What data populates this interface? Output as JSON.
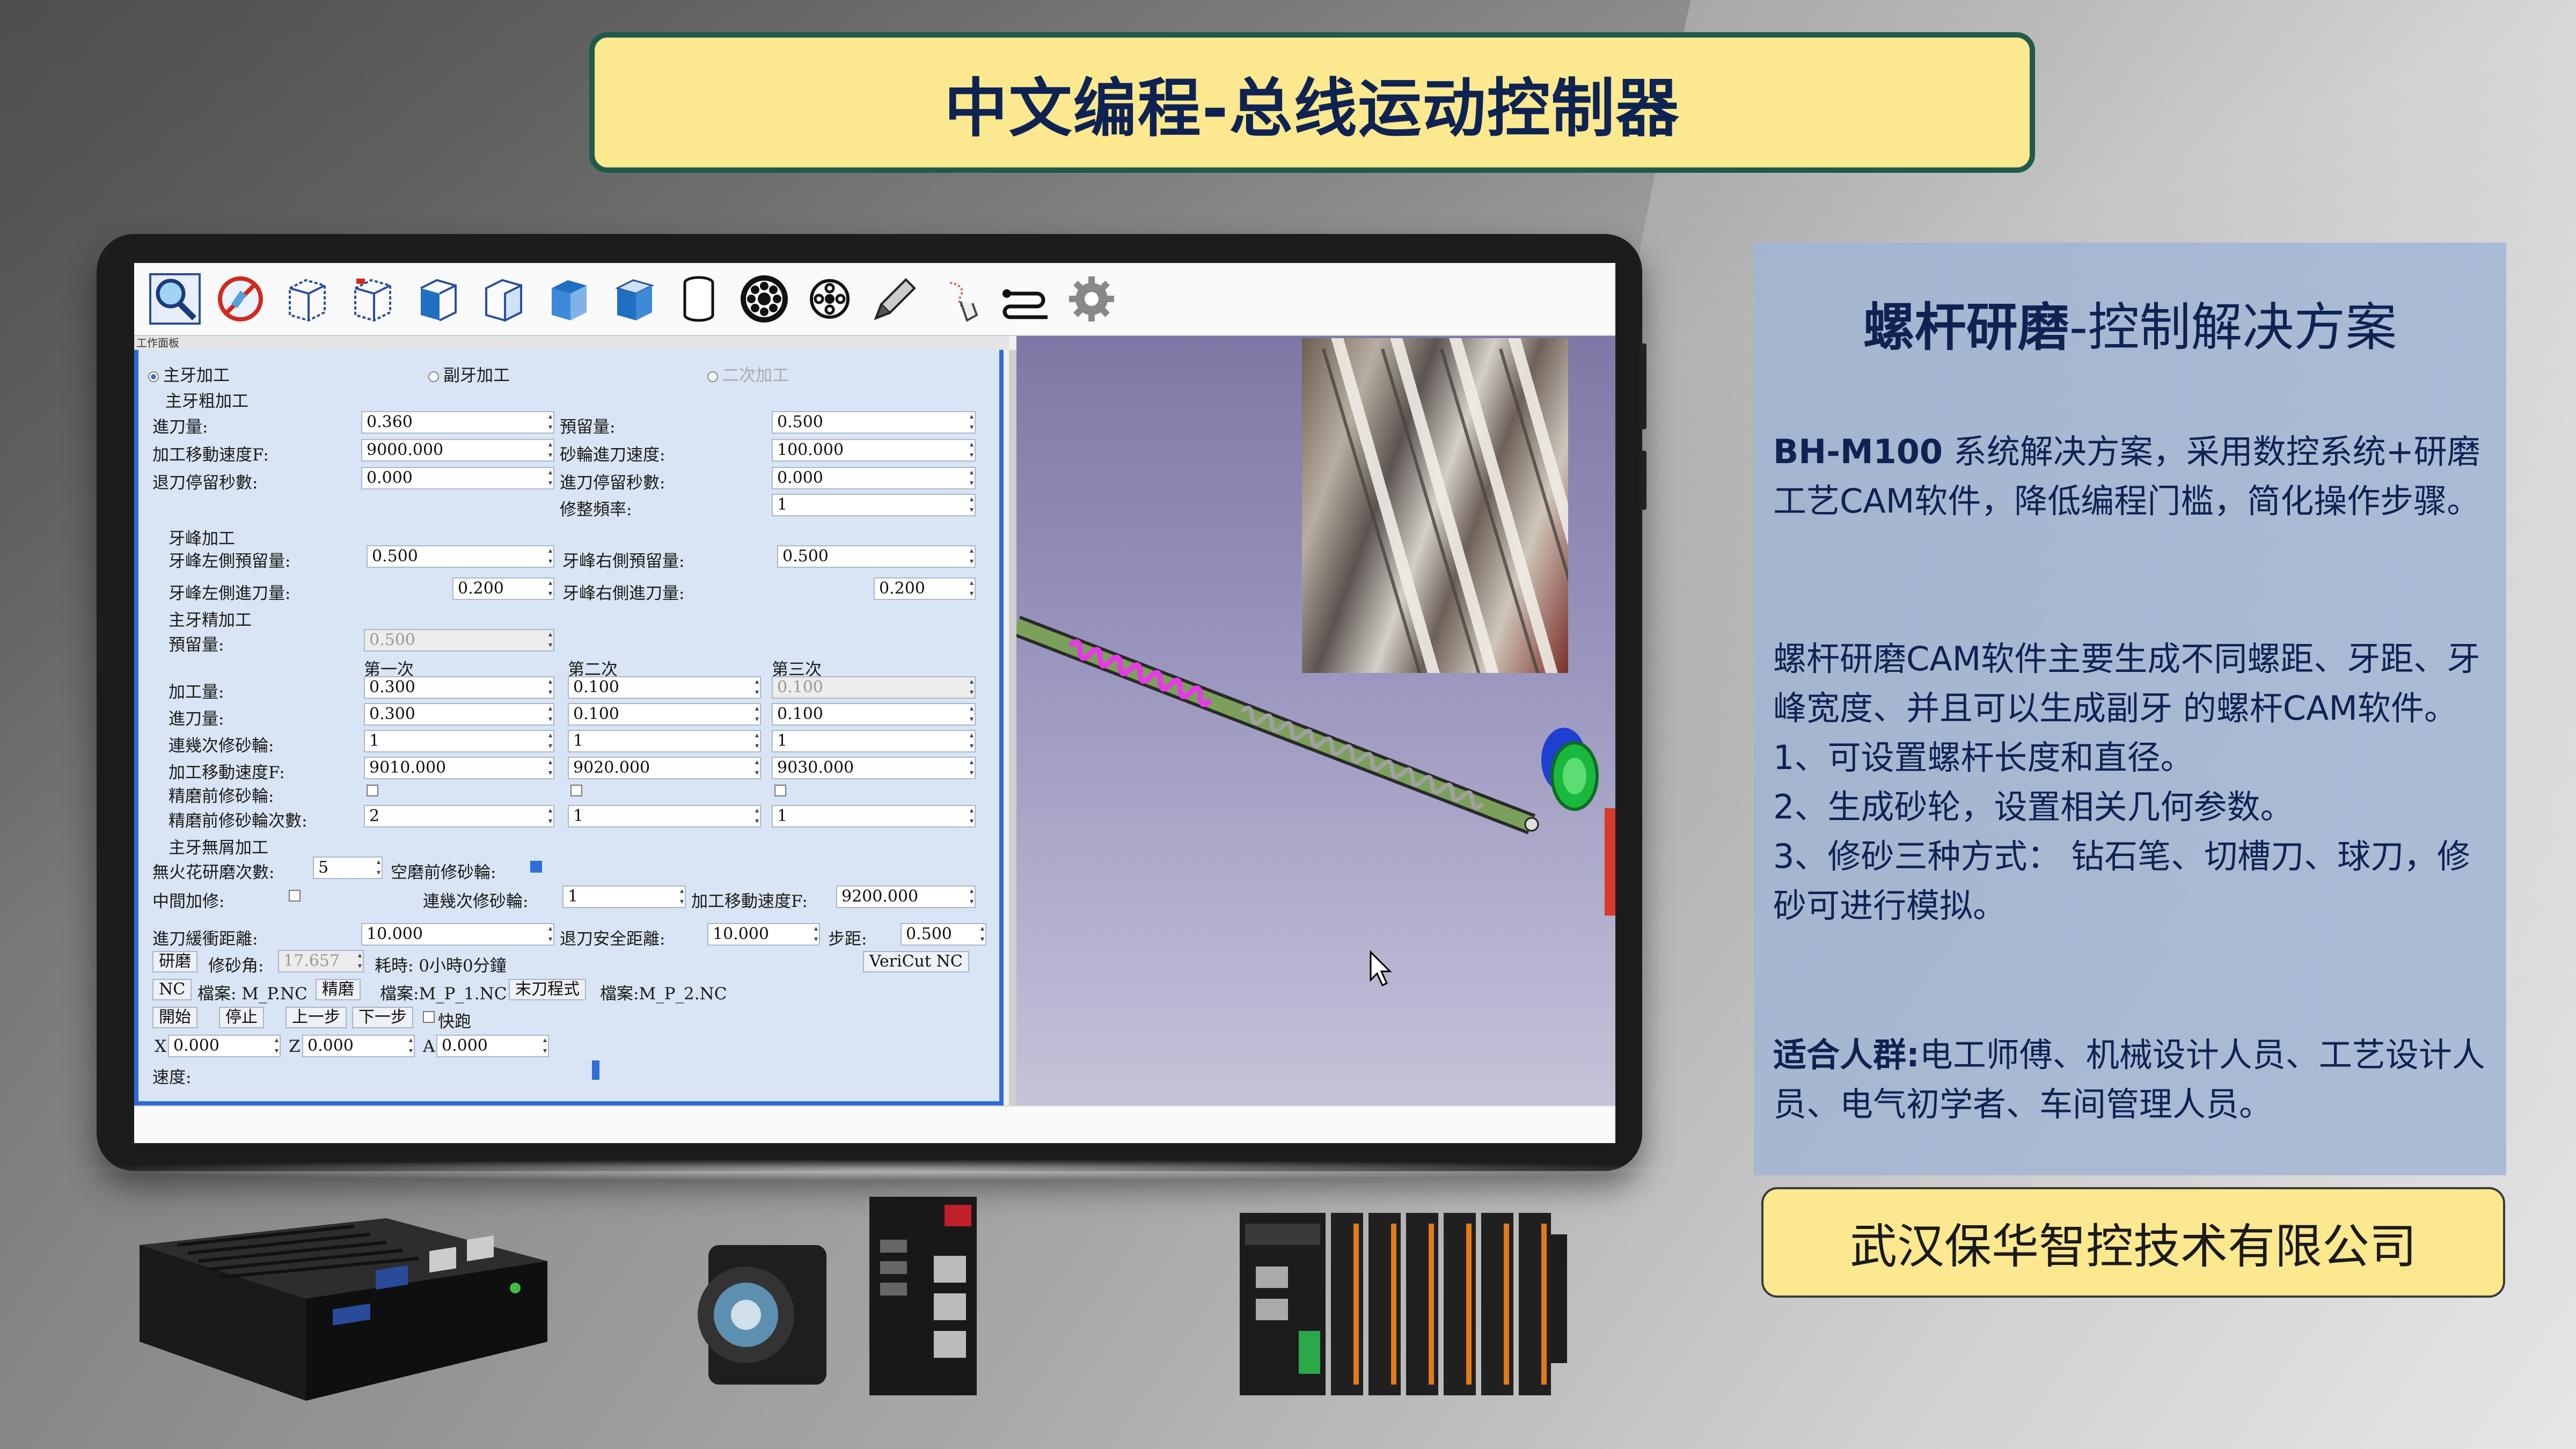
{
  "title": "中文编程-总线运动控制器",
  "software": {
    "panel_header": "工作面板",
    "radios": {
      "main": "主牙加工",
      "secondary": "副牙加工",
      "second_pass": "二次加工"
    },
    "rough": {
      "section": "主牙粗加工",
      "feed_label": "進刀量:",
      "feed_value": "0.360",
      "stock_label": "預留量:",
      "stock_value": "0.500",
      "speed_label": "加工移動速度F:",
      "speed_value": "9000.000",
      "wheel_feed_label": "砂輪進刀速度:",
      "wheel_feed_value": "100.000",
      "retract_label": "退刀停留秒數:",
      "retract_value": "0.000",
      "advance_label": "進刀停留秒數:",
      "advance_value": "0.000",
      "dress_label": "修整頻率:",
      "dress_value": "1"
    },
    "crest": {
      "section": "牙峰加工",
      "left_stock_label": "牙峰左側預留量:",
      "left_stock_value": "0.500",
      "right_stock_label": "牙峰右側預留量:",
      "right_stock_value": "0.500",
      "left_feed_label": "牙峰左側進刀量:",
      "left_feed_value": "0.200",
      "right_feed_label": "牙峰右側進刀量:",
      "right_feed_value": "0.200"
    },
    "finish": {
      "section": "主牙精加工",
      "stock_label": "預留量:",
      "stock_value": "0.500",
      "col1": "第一次",
      "col2": "第二次",
      "col3": "第三次",
      "rows": [
        {
          "label": "加工量:",
          "v1": "0.300",
          "v2": "0.100",
          "v3": "0.100"
        },
        {
          "label": "進刀量:",
          "v1": "0.300",
          "v2": "0.100",
          "v3": "0.100"
        },
        {
          "label": "連幾次修砂輪:",
          "v1": "1",
          "v2": "1",
          "v3": "1"
        },
        {
          "label": "加工移動速度F:",
          "v1": "9010.000",
          "v2": "9020.000",
          "v3": "9030.000"
        }
      ],
      "pre_dress_label": "精磨前修砂輪:",
      "pre_dress_count_label": "精磨前修砂輪次數:",
      "pc1": "2",
      "pc2": "1",
      "pc3": "1"
    },
    "spark": {
      "section": "主牙無屑加工",
      "spark_label": "無火花研磨次數:",
      "spark_value": "5",
      "pre_grind_label": "空磨前修砂輪:",
      "mid_label": "中間加修:",
      "consecutive_label": "連幾次修砂輪:",
      "consecutive_value": "1",
      "speed_label": "加工移動速度F:",
      "speed_value": "9200.000"
    },
    "misc": {
      "buffer_label": "進刀緩衝距離:",
      "buffer_value": "10.000",
      "safe_label": "退刀安全距離:",
      "safe_value": "10.000",
      "step_label": "步距:",
      "step_value": "0.500"
    },
    "grind_btn": "研磨",
    "angle_label": "修砂角:",
    "angle_value": "17.657",
    "time_label": "耗時: 0小時0分鐘",
    "vericut_btn": "VeriCut NC",
    "nc_btn": "NC",
    "file1": "檔案: M_P.NC",
    "finish_btn": "精磨",
    "file2": "檔案:M_P_1.NC",
    "end_btn": "末刀程式",
    "file3": "檔案:M_P_2.NC",
    "start_btn": "開始",
    "stop_btn": "停止",
    "prev_btn": "上一步",
    "next_btn": "下一步",
    "fast_label": "快跑",
    "x_label": "X",
    "x_value": "0.000",
    "z_label": "Z",
    "z_value": "0.000",
    "a_label": "A",
    "a_value": "0.000",
    "speed_label": "速度:"
  },
  "info": {
    "title_bold": "螺杆研磨",
    "title_rest": "-控制解决方案",
    "p1_bold": "BH-M100",
    "p1_rest": " 系统解决方案，采用数控系统+研磨工艺CAM软件，降低编程门槛，简化操作步骤。",
    "p2": "螺杆研磨CAM软件主要生成不同螺距、牙距、牙峰宽度、并且可以生成副牙 的螺杆CAM软件。",
    "p2_l1": "1、可设置螺杆长度和直径。",
    "p2_l2": "2、生成砂轮，设置相关几何参数。",
    "p2_l3": "3、修砂三种方式： 钻石笔、切槽刀、球刀，修砂可进行模拟。",
    "p3_bold": "适合人群:",
    "p3_rest": "电工师傅、机械设计人员、工艺设计人员、电气初学者、车间管理人员。"
  },
  "company": "武汉保华智控技术有限公司",
  "colors": {
    "title_bg": "#fbe88f",
    "title_border": "#1f5a4d",
    "navy": "#0e2352",
    "panel_blue": "#2e6bd6"
  }
}
